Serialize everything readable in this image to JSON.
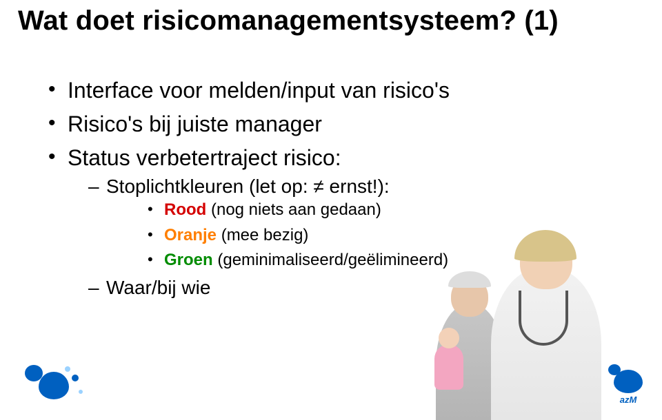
{
  "title": "Wat doet risicomanagementsysteem? (1)",
  "bullets": {
    "b1": "Interface voor melden/input van risico's",
    "b2": "Risico's bij juiste manager",
    "b3": "Status verbetertraject risico:",
    "b3_sub1_prefix": "Stoplichtkleuren (let op: ",
    "b3_sub1_neq": "≠",
    "b3_sub1_suffix": " ernst!):",
    "b3_sub1_a_label": "Rood",
    "b3_sub1_a_rest": " (nog niets aan gedaan)",
    "b3_sub1_b_label": "Oranje",
    "b3_sub1_b_rest": " (mee bezig)",
    "b3_sub1_c_label": "Groen",
    "b3_sub1_c_rest": " (geminimaliseerd/geëlimineerd)",
    "b3_sub2": "Waar/bij wie"
  },
  "logo_br": "azM",
  "colors": {
    "red": "#d40000",
    "orange": "#ff7f00",
    "green": "#008c00",
    "brand_blue": "#0060c0"
  }
}
